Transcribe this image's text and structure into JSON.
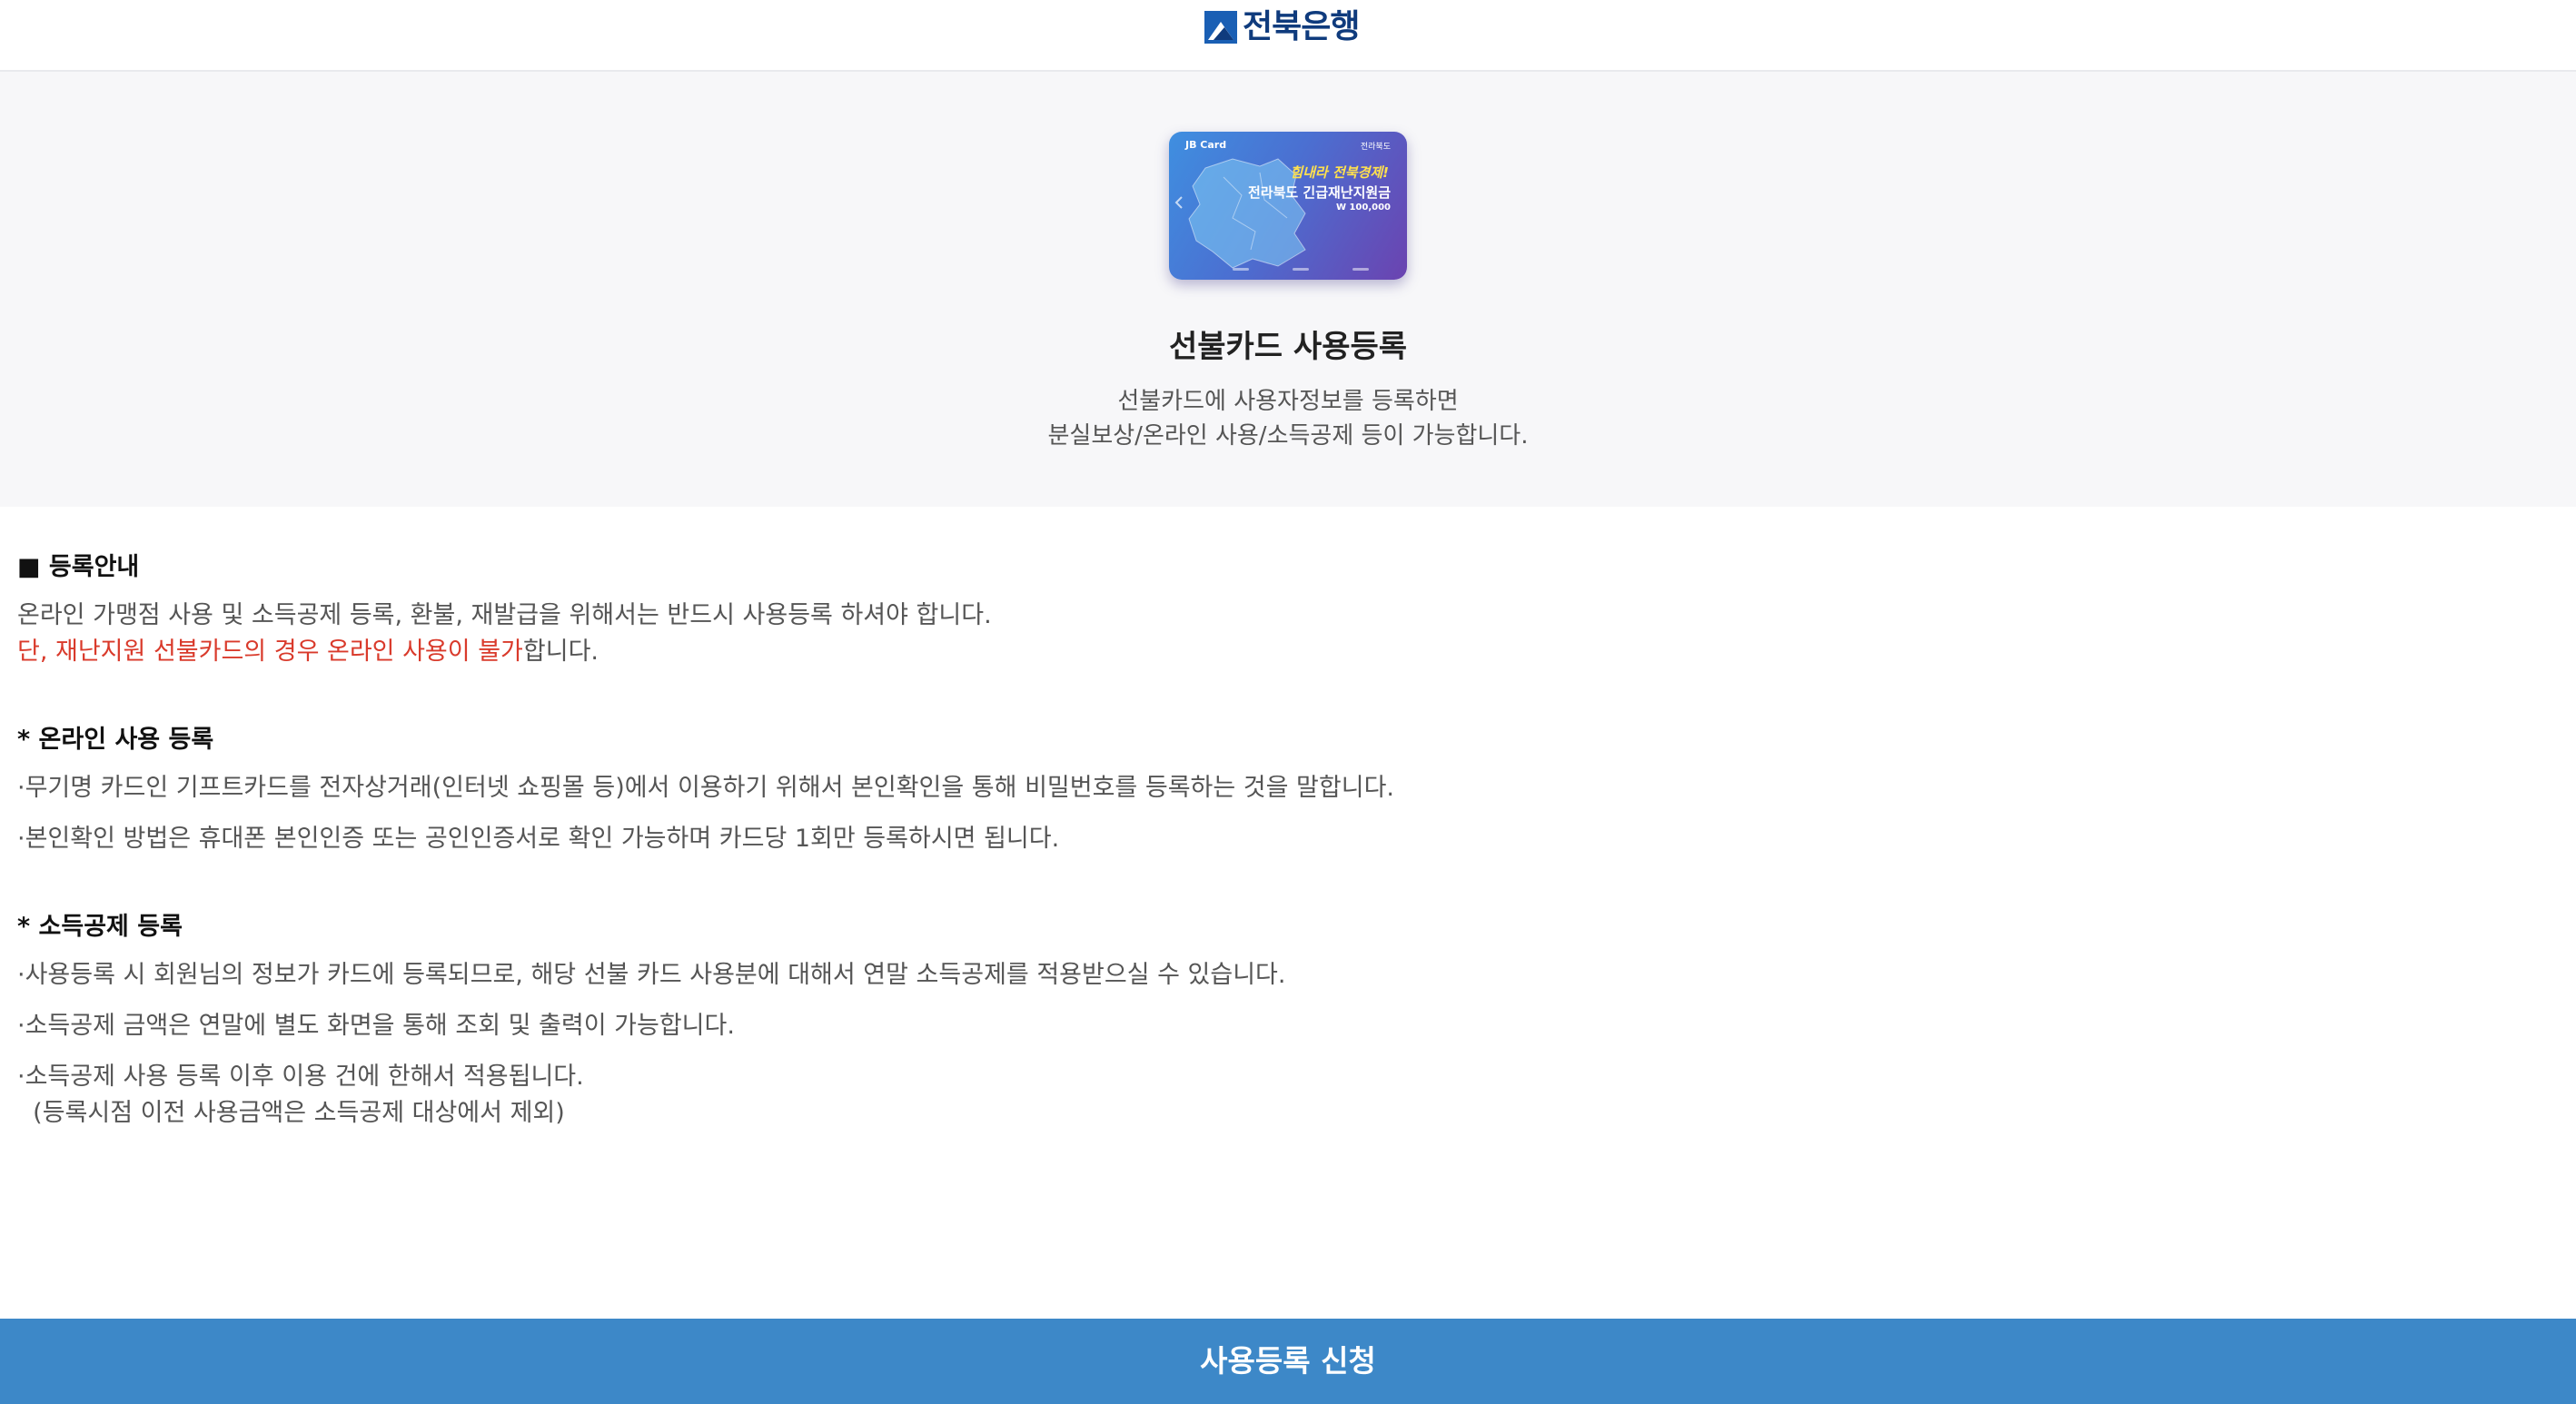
{
  "header": {
    "bank_name": "전북은행"
  },
  "hero": {
    "card": {
      "brand": "JB Card",
      "bank": "전라북도",
      "slogan": "힘내라 전북경제!",
      "title": "전라북도 긴급재난지원금",
      "amount": "W 100,000"
    },
    "title": "선불카드 사용등록",
    "desc_lines": [
      "선불카드에 사용자정보를 등록하면",
      "분실보상/온라인 사용/소득공제 등이 가능합니다."
    ]
  },
  "guide": {
    "title": "■ 등록안내",
    "line1": "온라인 가맹점 사용 및 소득공제 등록, 환불, 재발급을 위해서는 반드시 사용등록 하셔야 합니다.",
    "line2_red": "단, 재난지원 선불카드의 경우 온라인 사용이 불가",
    "line2_rest": "합니다."
  },
  "online": {
    "title": "* 온라인 사용 등록",
    "bullets": [
      "·무기명 카드인 기프트카드를 전자상거래(인터넷 쇼핑몰 등)에서 이용하기 위해서 본인확인을 통해 비밀번호를 등록하는 것을 말합니다.",
      "·본인확인 방법은 휴대폰 본인인증 또는 공인인증서로 확인 가능하며 카드당 1회만 등록하시면 됩니다."
    ]
  },
  "deduction": {
    "title": "* 소득공제 등록",
    "bullets": [
      "·사용등록 시 회원님의 정보가 카드에 등록되므로, 해당 선불 카드 사용분에 대해서 연말 소득공제를 적용받으실 수 있습니다.",
      "·소득공제 금액은 연말에 별도 화면을 통해 조회 및 출력이 가능합니다.",
      "·소득공제 사용 등록 이후 이용 건에 한해서 적용됩니다."
    ],
    "note": "  (등록시점 이전 사용금액은 소득공제 대상에서 제외)"
  },
  "footer": {
    "submit_label": "사용등록 신청",
    "color": "#3d88c8"
  }
}
